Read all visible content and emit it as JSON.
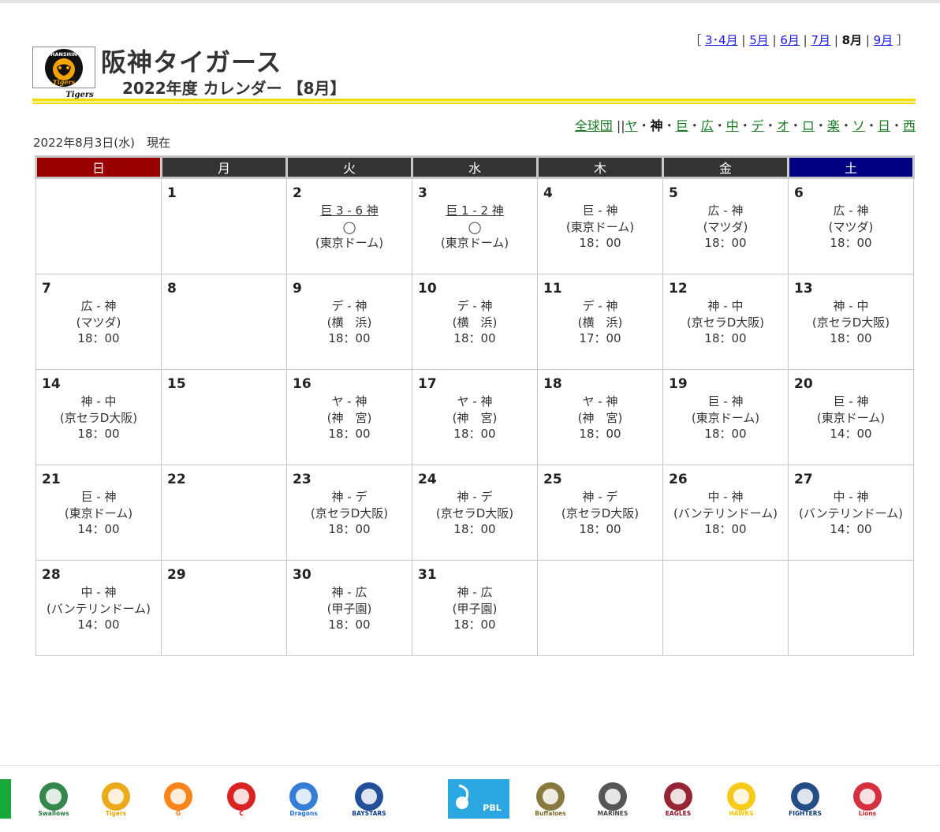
{
  "header": {
    "title": "阪神タイガース",
    "subtitle": "2022年度 カレンダー 【8月】",
    "logo_text_top": "HANSHIN",
    "logo_text_bottom": "Tigers",
    "date_now": "2022年8月3日(水)　現在"
  },
  "months": {
    "open": "［",
    "close": "］",
    "sep": " | ",
    "items": [
      {
        "label": "3･4月",
        "current": false
      },
      {
        "label": "5月",
        "current": false
      },
      {
        "label": "6月",
        "current": false
      },
      {
        "label": "7月",
        "current": false
      },
      {
        "label": "8月",
        "current": true
      },
      {
        "label": "9月",
        "current": false
      }
    ]
  },
  "teamnav": {
    "all_label": "全球団",
    "divider": "||",
    "sep": "・",
    "teams": [
      {
        "label": "ヤ",
        "current": false
      },
      {
        "label": "神",
        "current": true
      },
      {
        "label": "巨",
        "current": false
      },
      {
        "label": "広",
        "current": false
      },
      {
        "label": "中",
        "current": false
      },
      {
        "label": "デ",
        "current": false
      },
      {
        "label": "オ",
        "current": false
      },
      {
        "label": "ロ",
        "current": false
      },
      {
        "label": "楽",
        "current": false
      },
      {
        "label": "ソ",
        "current": false
      },
      {
        "label": "日",
        "current": false
      },
      {
        "label": "西",
        "current": false
      }
    ]
  },
  "weekdays": [
    "日",
    "月",
    "火",
    "水",
    "木",
    "金",
    "土"
  ],
  "weeks": [
    [
      null,
      {
        "day": "1",
        "lines": []
      },
      {
        "day": "2",
        "match": "巨 3 - 6 神",
        "link": true,
        "lines": [
          "◯",
          "(東京ドーム)"
        ]
      },
      {
        "day": "3",
        "match": "巨 1 - 2 神",
        "link": true,
        "lines": [
          "◯",
          "(東京ドーム)"
        ]
      },
      {
        "day": "4",
        "match": "巨 - 神",
        "link": false,
        "lines": [
          "(東京ドーム)",
          "18：00"
        ]
      },
      {
        "day": "5",
        "match": "広 - 神",
        "link": false,
        "lines": [
          "(マツダ)",
          "18：00"
        ]
      },
      {
        "day": "6",
        "match": "広 - 神",
        "link": false,
        "lines": [
          "(マツダ)",
          "18：00"
        ]
      }
    ],
    [
      {
        "day": "7",
        "match": "広 - 神",
        "link": false,
        "lines": [
          "(マツダ)",
          "18：00"
        ]
      },
      {
        "day": "8",
        "lines": []
      },
      {
        "day": "9",
        "match": "デ - 神",
        "link": false,
        "lines": [
          "(横　浜)",
          "18：00"
        ]
      },
      {
        "day": "10",
        "match": "デ - 神",
        "link": false,
        "lines": [
          "(横　浜)",
          "18：00"
        ]
      },
      {
        "day": "11",
        "match": "デ - 神",
        "link": false,
        "lines": [
          "(横　浜)",
          "17：00"
        ]
      },
      {
        "day": "12",
        "match": "神 - 中",
        "link": false,
        "lines": [
          "(京セラD大阪)",
          "18：00"
        ]
      },
      {
        "day": "13",
        "match": "神 - 中",
        "link": false,
        "lines": [
          "(京セラD大阪)",
          "18：00"
        ]
      }
    ],
    [
      {
        "day": "14",
        "match": "神 - 中",
        "link": false,
        "lines": [
          "(京セラD大阪)",
          "18：00"
        ]
      },
      {
        "day": "15",
        "lines": []
      },
      {
        "day": "16",
        "match": "ヤ - 神",
        "link": false,
        "lines": [
          "(神　宮)",
          "18：00"
        ]
      },
      {
        "day": "17",
        "match": "ヤ - 神",
        "link": false,
        "lines": [
          "(神　宮)",
          "18：00"
        ]
      },
      {
        "day": "18",
        "match": "ヤ - 神",
        "link": false,
        "lines": [
          "(神　宮)",
          "18：00"
        ]
      },
      {
        "day": "19",
        "match": "巨 - 神",
        "link": false,
        "lines": [
          "(東京ドーム)",
          "18：00"
        ]
      },
      {
        "day": "20",
        "match": "巨 - 神",
        "link": false,
        "lines": [
          "(東京ドーム)",
          "14：00"
        ]
      }
    ],
    [
      {
        "day": "21",
        "match": "巨 - 神",
        "link": false,
        "lines": [
          "(東京ドーム)",
          "14：00"
        ]
      },
      {
        "day": "22",
        "lines": []
      },
      {
        "day": "23",
        "match": "神 - デ",
        "link": false,
        "lines": [
          "(京セラD大阪)",
          "18：00"
        ]
      },
      {
        "day": "24",
        "match": "神 - デ",
        "link": false,
        "lines": [
          "(京セラD大阪)",
          "18：00"
        ]
      },
      {
        "day": "25",
        "match": "神 - デ",
        "link": false,
        "lines": [
          "(京セラD大阪)",
          "18：00"
        ]
      },
      {
        "day": "26",
        "match": "中 - 神",
        "link": false,
        "lines": [
          "(バンテリンドーム)",
          "18：00"
        ]
      },
      {
        "day": "27",
        "match": "中 - 神",
        "link": false,
        "lines": [
          "(バンテリンドーム)",
          "14：00"
        ]
      }
    ],
    [
      {
        "day": "28",
        "match": "中 - 神",
        "link": false,
        "lines": [
          "(バンテリンドーム)",
          "14：00"
        ]
      },
      {
        "day": "29",
        "lines": []
      },
      {
        "day": "30",
        "match": "神 - 広",
        "link": false,
        "lines": [
          "(甲子園)",
          "18：00"
        ]
      },
      {
        "day": "31",
        "match": "神 - 広",
        "link": false,
        "lines": [
          "(甲子園)",
          "18：00"
        ]
      },
      null,
      null,
      null
    ]
  ],
  "footer_logos": [
    {
      "icon": "swallows-logo-icon",
      "text": "Swallows",
      "color": "#1f7a3a"
    },
    {
      "icon": "tigers-logo-icon",
      "text": "Tigers",
      "color": "#e8a100"
    },
    {
      "icon": "giants-logo-icon",
      "text": "G",
      "color": "#f97700"
    },
    {
      "icon": "carp-logo-icon",
      "text": "C",
      "color": "#d60a0a"
    },
    {
      "icon": "dragons-logo-icon",
      "text": "Dragons",
      "color": "#1f6fd1"
    },
    {
      "icon": "baystars-logo-icon",
      "text": "BAYSTARS",
      "color": "#0a3c8c"
    },
    {
      "icon": "pbl-logo-icon",
      "text": "PBL",
      "color": "#2aa7e0"
    },
    {
      "icon": "buffaloes-logo-icon",
      "text": "Buffaloes",
      "color": "#7a6a2a"
    },
    {
      "icon": "marines-logo-icon",
      "text": "MARINES",
      "color": "#444444"
    },
    {
      "icon": "eagles-logo-icon",
      "text": "EAGLES",
      "color": "#8a0c1e"
    },
    {
      "icon": "hawks-logo-icon",
      "text": "HAWKS",
      "color": "#f5c400"
    },
    {
      "icon": "fighters-logo-icon",
      "text": "FIGHTERS",
      "color": "#0c3a7a"
    },
    {
      "icon": "lions-logo-icon",
      "text": "Lions",
      "color": "#d01a2a"
    }
  ]
}
